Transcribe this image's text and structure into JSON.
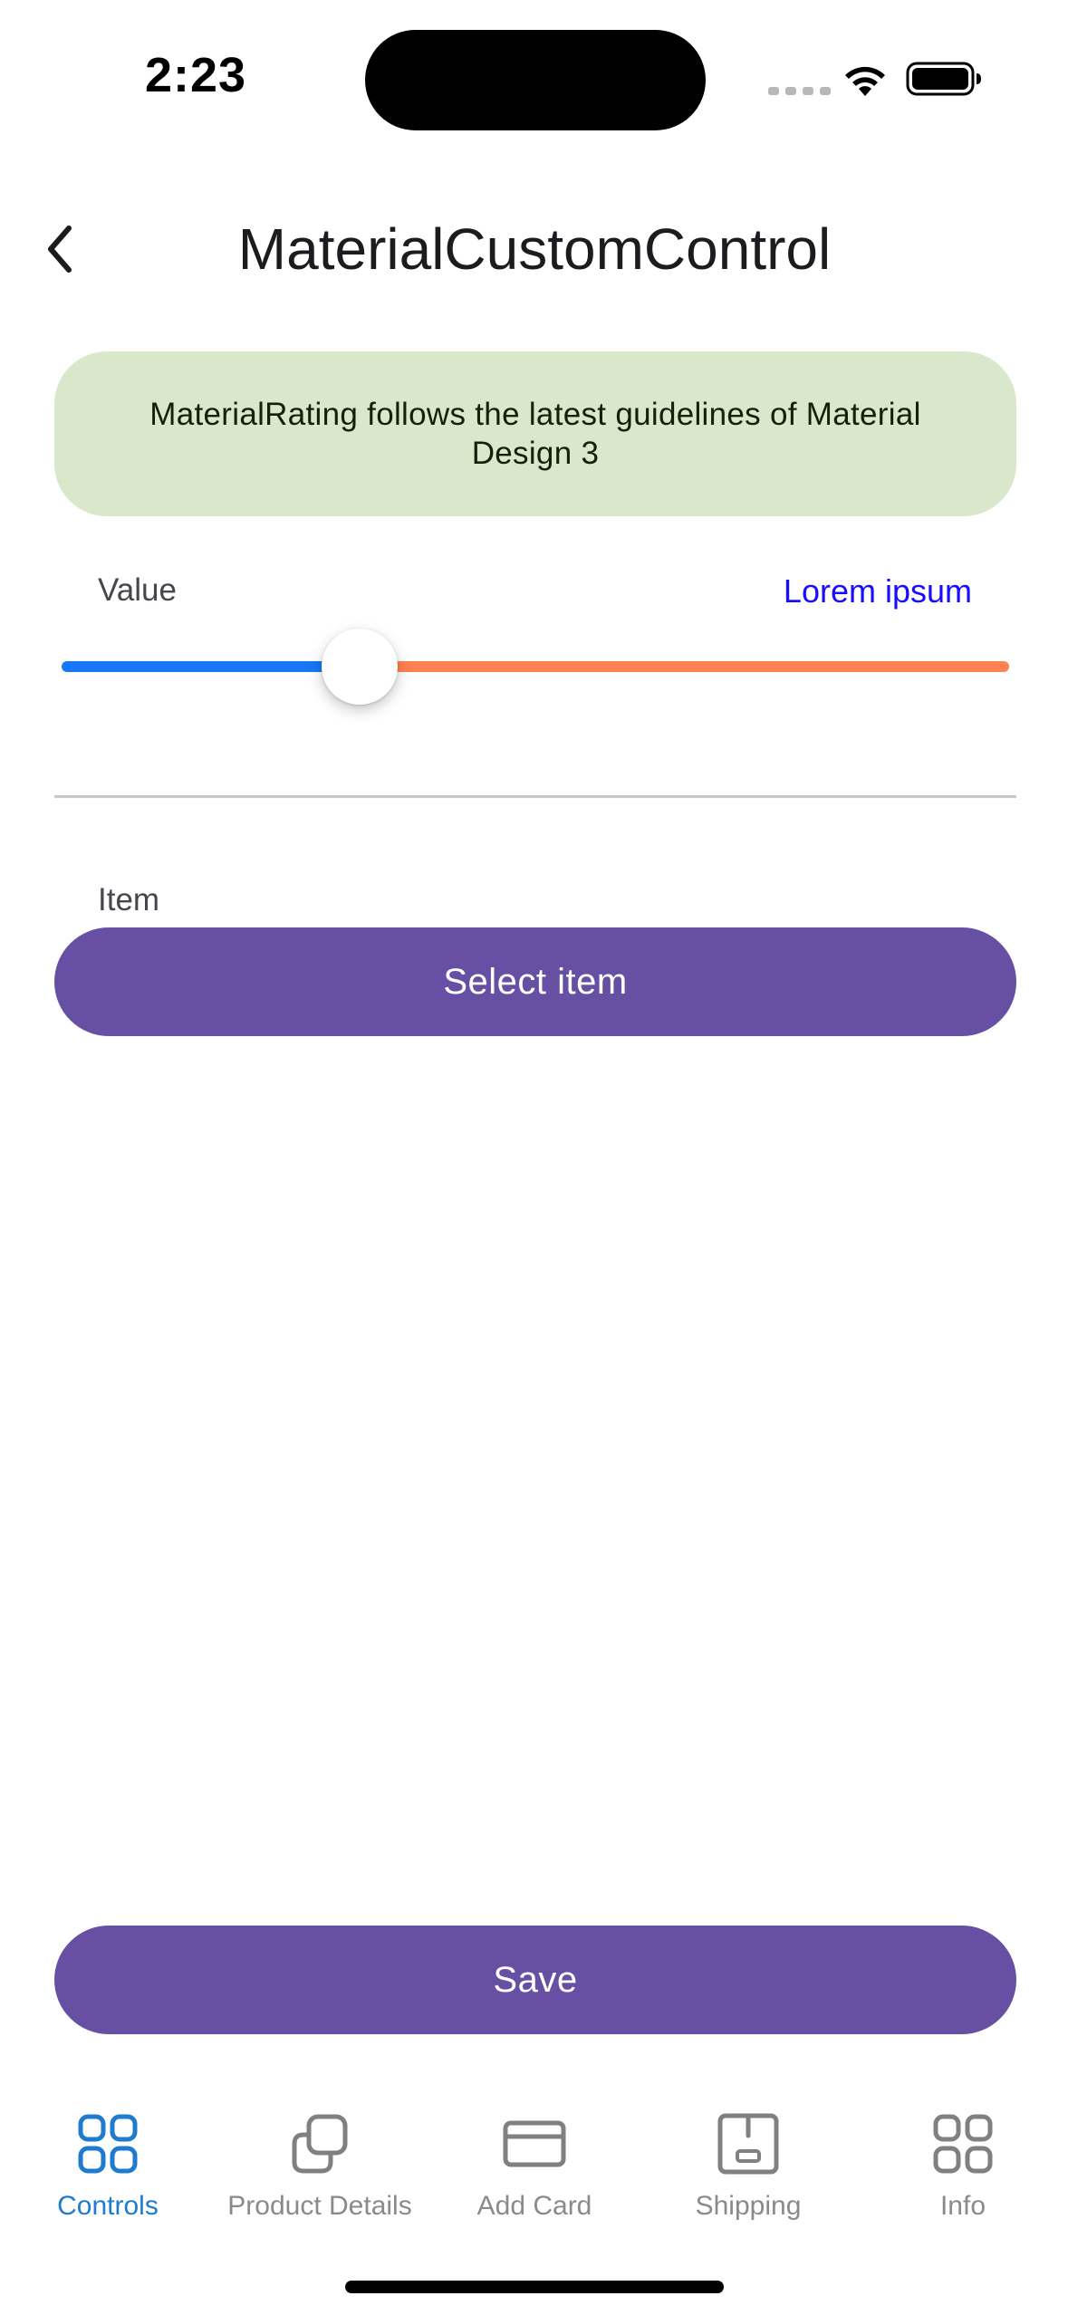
{
  "status_bar": {
    "time": "2:23"
  },
  "header": {
    "title": "MaterialCustomControl"
  },
  "banner": {
    "text": "MaterialRating follows the latest guidelines of Material Design 3"
  },
  "value_field": {
    "label": "Value",
    "aux_text": "Lorem ipsum",
    "slider_fraction": 0.315,
    "active_color": "#1877f2",
    "inactive_color": "#ff8050"
  },
  "item_field": {
    "label": "Item",
    "button_label": "Select item"
  },
  "save_button": {
    "label": "Save"
  },
  "accent_color": "#6750a4",
  "tabs": [
    {
      "label": "Controls",
      "icon": "grid-icon",
      "active": true
    },
    {
      "label": "Product Details",
      "icon": "copy-icon",
      "active": false
    },
    {
      "label": "Add Card",
      "icon": "credit-card-icon",
      "active": false
    },
    {
      "label": "Shipping",
      "icon": "box-icon",
      "active": false
    },
    {
      "label": "Info",
      "icon": "grid-icon",
      "active": false
    }
  ]
}
